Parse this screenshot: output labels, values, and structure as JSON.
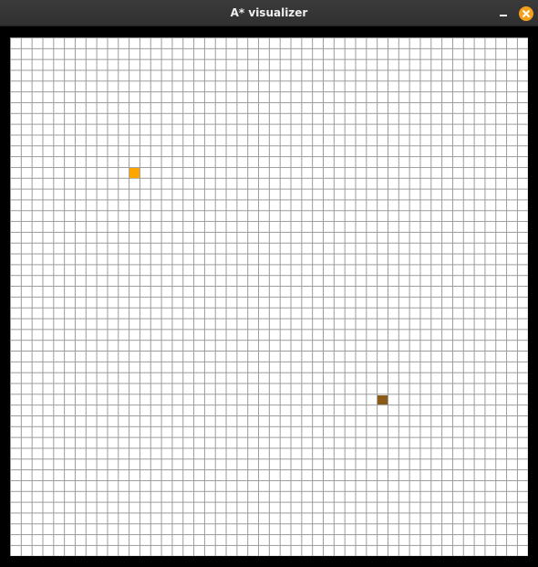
{
  "window": {
    "title": "A* visualizer",
    "controls": [
      {
        "name": "minimize-button",
        "icon": "minimize-icon"
      },
      {
        "name": "close-button",
        "icon": "close-icon",
        "color": "#f6a01a"
      }
    ]
  },
  "grid": {
    "rows": 48,
    "cols": 48,
    "cell_colors": {
      "empty": "#ffffff",
      "line": "#9a9a9a",
      "border": "#000000",
      "start": "#ffa500",
      "end": "#8b5a18"
    },
    "start": {
      "row": 12,
      "col": 11
    },
    "end": {
      "row": 33,
      "col": 34
    }
  }
}
